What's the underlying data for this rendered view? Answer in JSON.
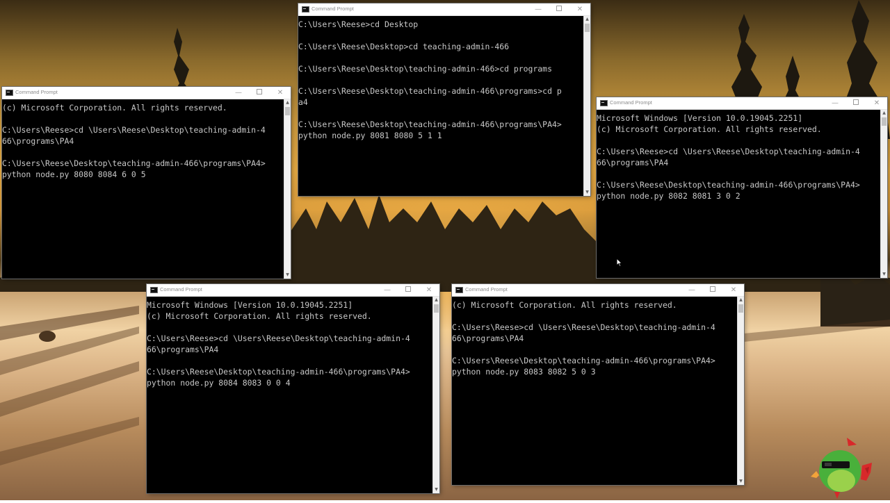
{
  "windows": [
    {
      "title": "Command Prompt",
      "lines": [
        "C:\\Users\\Reese>cd Desktop",
        "",
        "C:\\Users\\Reese\\Desktop>cd teaching-admin-466",
        "",
        "C:\\Users\\Reese\\Desktop\\teaching-admin-466>cd programs",
        "",
        "C:\\Users\\Reese\\Desktop\\teaching-admin-466\\programs>cd p",
        "a4",
        "",
        "C:\\Users\\Reese\\Desktop\\teaching-admin-466\\programs\\PA4>",
        "python node.py 8081 8080 5 1 1"
      ]
    },
    {
      "title": "Command Prompt",
      "lines": [
        "(c) Microsoft Corporation. All rights reserved.",
        "",
        "C:\\Users\\Reese>cd \\Users\\Reese\\Desktop\\teaching-admin-4",
        "66\\programs\\PA4",
        "",
        "C:\\Users\\Reese\\Desktop\\teaching-admin-466\\programs\\PA4>",
        "python node.py 8080 8084 6 0 5"
      ]
    },
    {
      "title": "Command Prompt",
      "lines": [
        "Microsoft Windows [Version 10.0.19045.2251]",
        "(c) Microsoft Corporation. All rights reserved.",
        "",
        "C:\\Users\\Reese>cd \\Users\\Reese\\Desktop\\teaching-admin-4",
        "66\\programs\\PA4",
        "",
        "C:\\Users\\Reese\\Desktop\\teaching-admin-466\\programs\\PA4>",
        "python node.py 8082 8081 3 0 2"
      ]
    },
    {
      "title": "Command Prompt",
      "lines": [
        "Microsoft Windows [Version 10.0.19045.2251]",
        "(c) Microsoft Corporation. All rights reserved.",
        "",
        "C:\\Users\\Reese>cd \\Users\\Reese\\Desktop\\teaching-admin-4",
        "66\\programs\\PA4",
        "",
        "C:\\Users\\Reese\\Desktop\\teaching-admin-466\\programs\\PA4>",
        "python node.py 8084 8083 0 0 4"
      ]
    },
    {
      "title": "Command Prompt",
      "lines": [
        "(c) Microsoft Corporation. All rights reserved.",
        "",
        "C:\\Users\\Reese>cd \\Users\\Reese\\Desktop\\teaching-admin-4",
        "66\\programs\\PA4",
        "",
        "C:\\Users\\Reese\\Desktop\\teaching-admin-466\\programs\\PA4>",
        "python node.py 8083 8082 5 0 3"
      ]
    }
  ],
  "titlebar_buttons": {
    "minimize": "—",
    "close": "✕"
  },
  "icons": {
    "console": "cmd-icon",
    "cursor": "mouse-pointer-icon",
    "mascot": "parrot-mascot-icon"
  },
  "colors": {
    "console_bg": "#000000",
    "console_text": "#c8c8c8",
    "titlebar_bg": "#ffffff",
    "scrollbar_bg": "#f0f0f0"
  }
}
